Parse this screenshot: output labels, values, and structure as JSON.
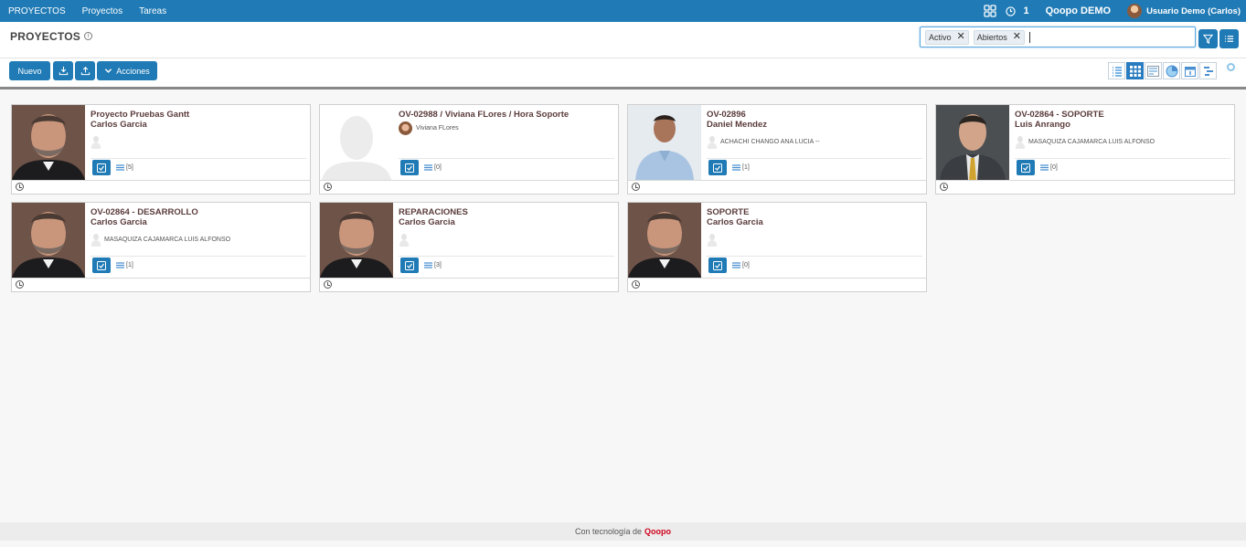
{
  "topbar": {
    "nav": [
      "PROYECTOS",
      "Proyectos",
      "Tareas"
    ],
    "notifications": "1",
    "company": "Qoopo DEMO",
    "user": "Usuario Demo (Carlos)"
  },
  "header": {
    "title": "PROYECTOS",
    "filters": [
      "Activo",
      "Abiertos"
    ]
  },
  "toolbar": {
    "new_label": "Nuevo",
    "actions_label": "Acciones"
  },
  "cards": [
    {
      "title": "Proyecto Pruebas Gantt",
      "subtitle": "Carlos Garcia",
      "person": "",
      "count": "[5]",
      "photo": "man-beard"
    },
    {
      "title": "OV-02988 / Viviana FLores / Hora Soporte",
      "subtitle": "",
      "person": "Viviana FLores",
      "count": "[0]",
      "photo": "placeholder"
    },
    {
      "title": "OV-02896",
      "subtitle": "Daniel Mendez",
      "person": "ACHACHI CHANGO ANA LUCIA --",
      "count": "[1]",
      "photo": "man-smile"
    },
    {
      "title": "OV-02864 - SOPORTE",
      "subtitle": "Luis Anrango",
      "person": "MASAQUIZA CAJAMARCA LUIS ALFONSO",
      "count": "[0]",
      "photo": "man-suit"
    },
    {
      "title": "OV-02864 - DESARROLLO",
      "subtitle": "Carlos Garcia",
      "person": "MASAQUIZA CAJAMARCA LUIS ALFONSO",
      "count": "[1]",
      "photo": "man-beard"
    },
    {
      "title": "REPARACIONES",
      "subtitle": "Carlos Garcia",
      "person": "",
      "count": "[3]",
      "photo": "man-beard"
    },
    {
      "title": "SOPORTE",
      "subtitle": "Carlos Garcia",
      "person": "",
      "count": "[0]",
      "photo": "man-beard"
    }
  ],
  "footer": {
    "text": "Con tecnología de",
    "brand": "Qoopo"
  },
  "colors": {
    "primary": "#1f7ab5",
    "brand": "#d0021b"
  }
}
